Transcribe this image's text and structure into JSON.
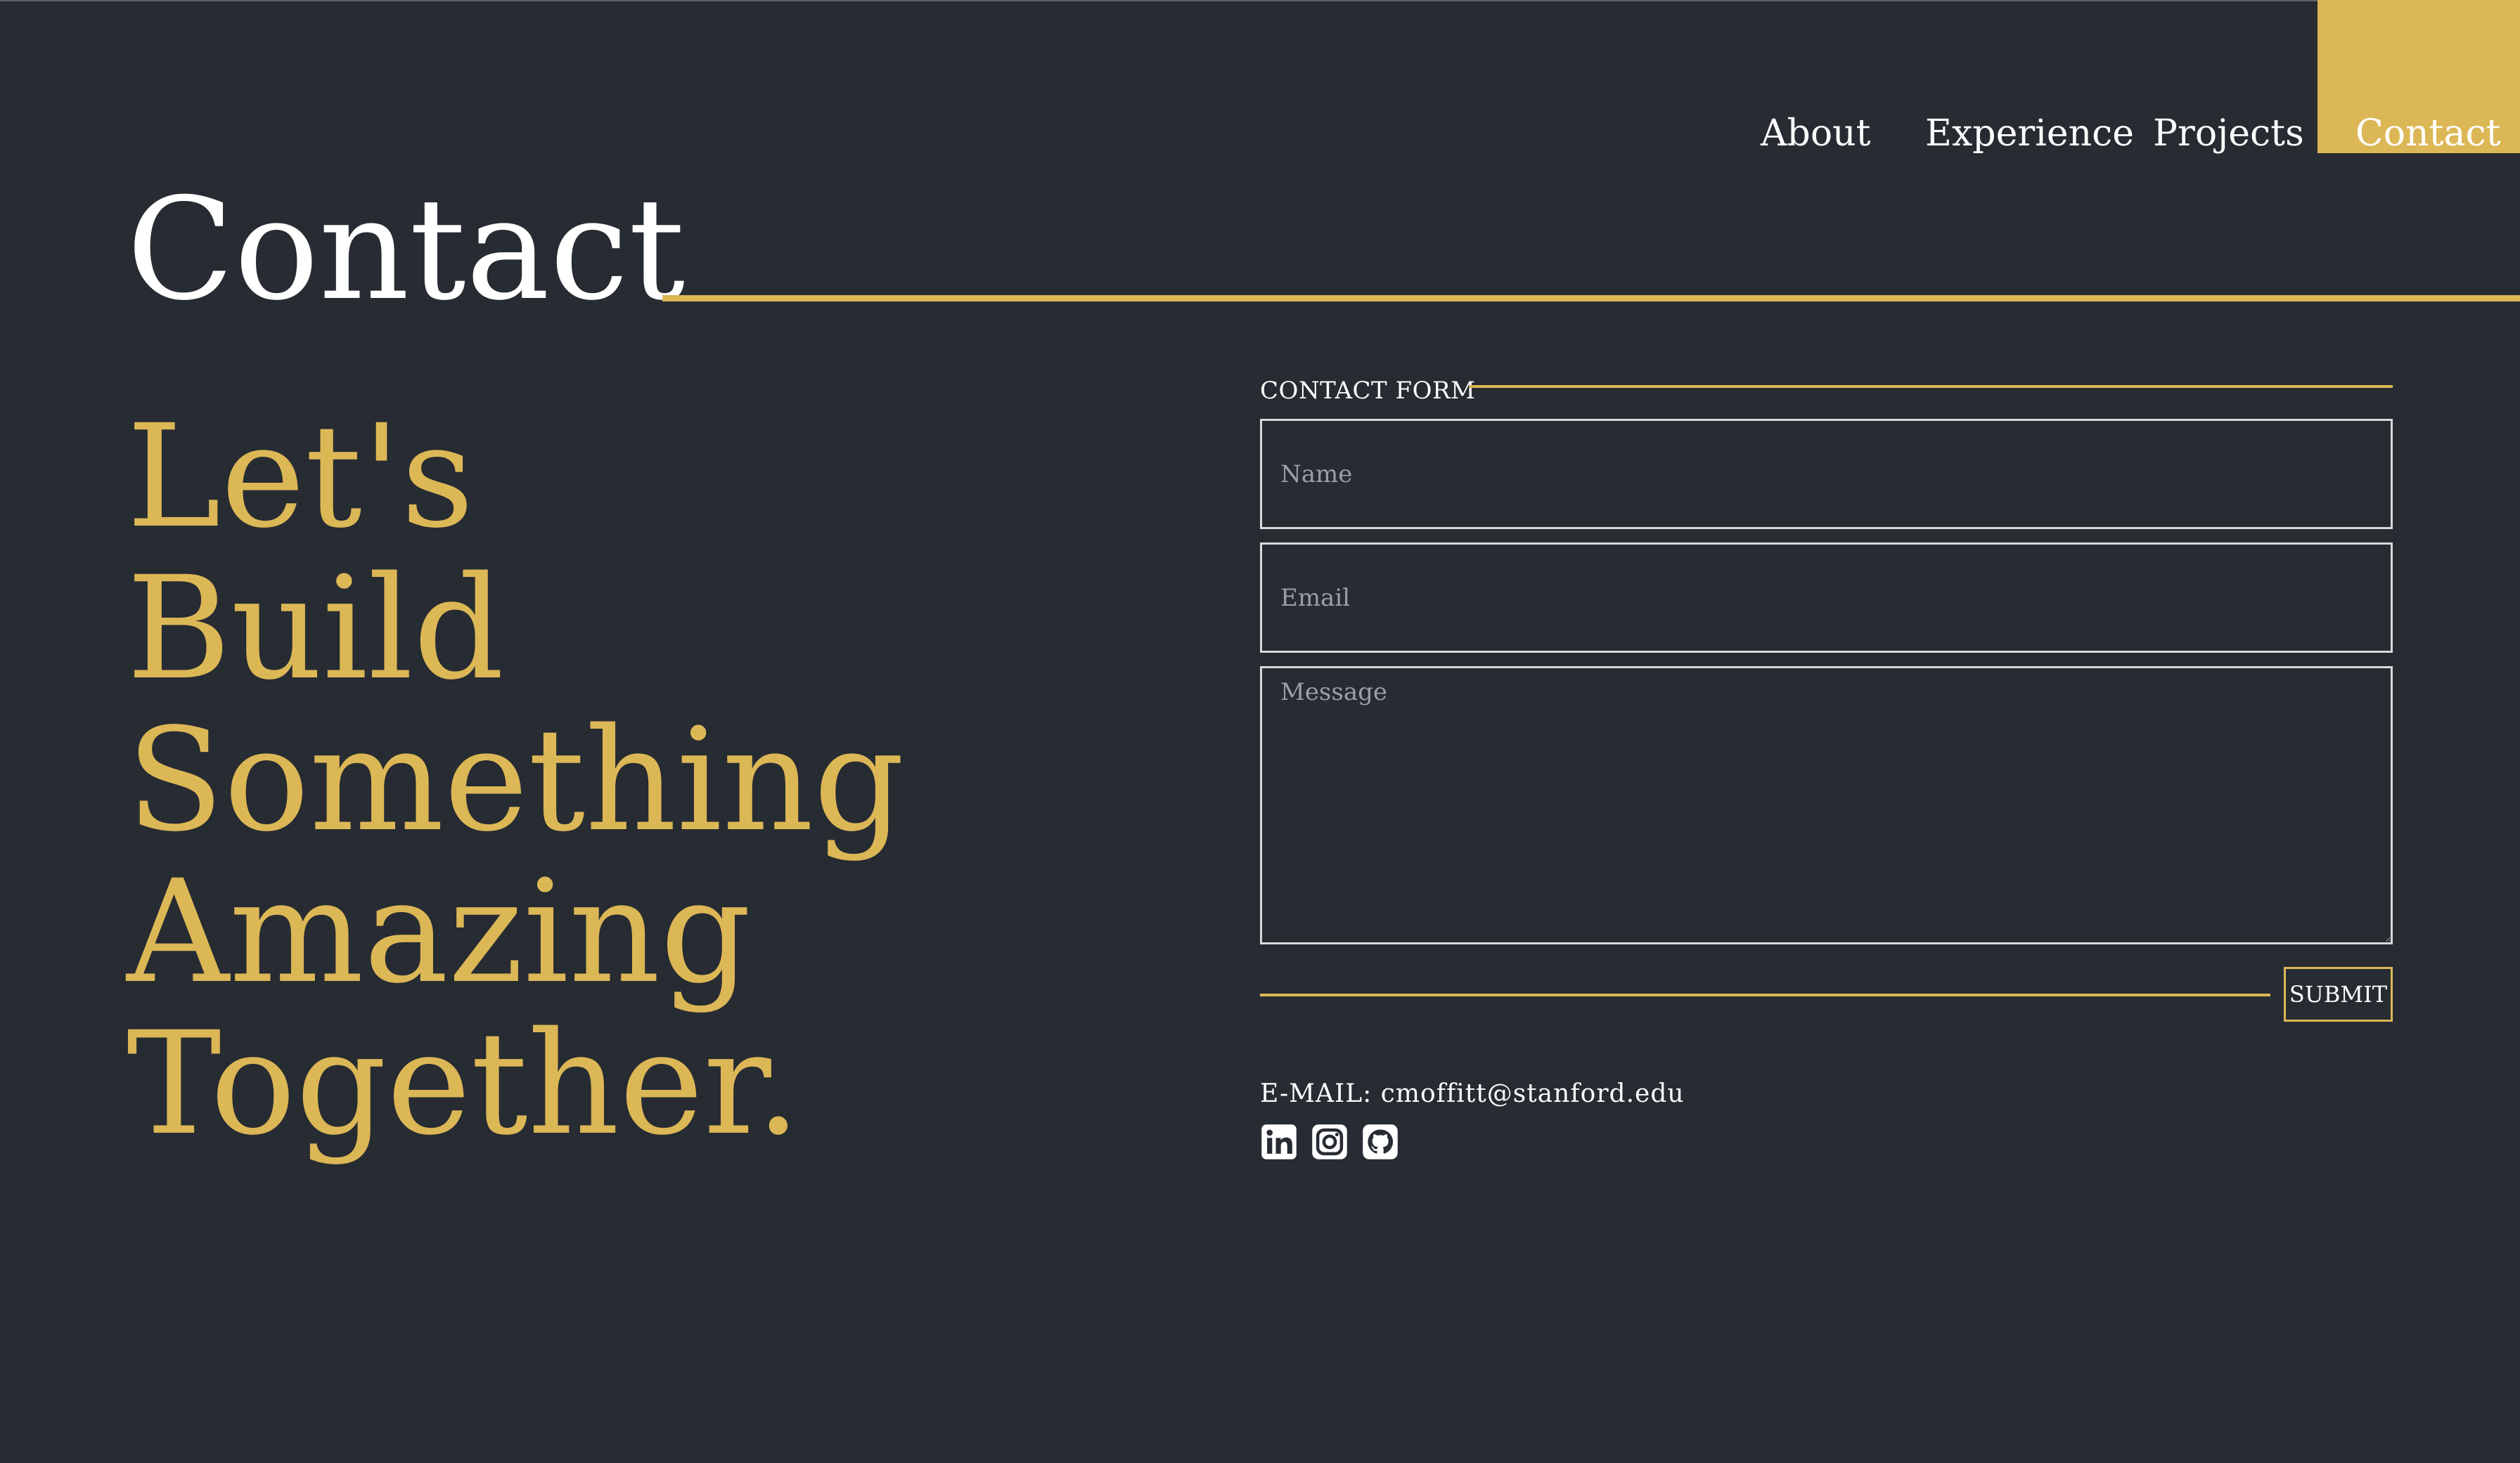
{
  "nav": {
    "items": [
      {
        "label": "About"
      },
      {
        "label": "Experience"
      },
      {
        "label": "Projects"
      },
      {
        "label": "Contact",
        "active": true
      }
    ]
  },
  "page": {
    "title": "Contact"
  },
  "headline": {
    "lines": [
      "Let's",
      "Build",
      "Something",
      "Amazing",
      "Together."
    ]
  },
  "form": {
    "label": "CONTACT FORM",
    "name_placeholder": "Name",
    "name_value": "",
    "email_placeholder": "Email",
    "email_value": "",
    "message_placeholder": "Message",
    "message_value": "",
    "submit_label": "SUBMIT"
  },
  "contact": {
    "email_line": "E-MAIL: cmoffitt@stanford.edu"
  },
  "social": {
    "icons": [
      "linkedin-icon",
      "instagram-icon",
      "github-icon"
    ]
  },
  "colors": {
    "background": "#272b32",
    "accent": "#dcb756",
    "text": "#ffffff",
    "field_border": "#d9d9d9"
  }
}
